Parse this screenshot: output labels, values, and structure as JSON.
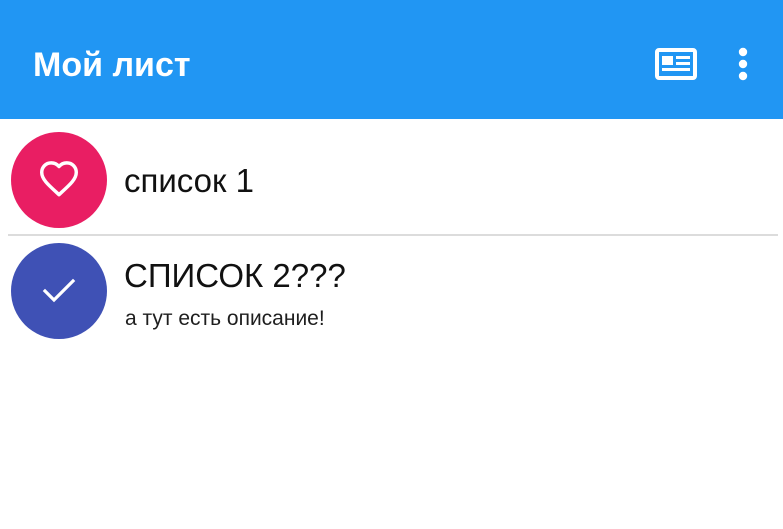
{
  "app_bar": {
    "title": "Мой лист",
    "background_color": "#2196f3",
    "actions": [
      {
        "icon": "news-icon"
      },
      {
        "icon": "more-vert-icon"
      }
    ]
  },
  "lists": [
    {
      "title": "список 1",
      "description": "",
      "icon": "heart-outline-icon",
      "avatar_color": "#e91e63"
    },
    {
      "title": "СПИСОК 2???",
      "description": "а тут есть описание!",
      "icon": "check-icon",
      "avatar_color": "#3f51b5"
    }
  ]
}
